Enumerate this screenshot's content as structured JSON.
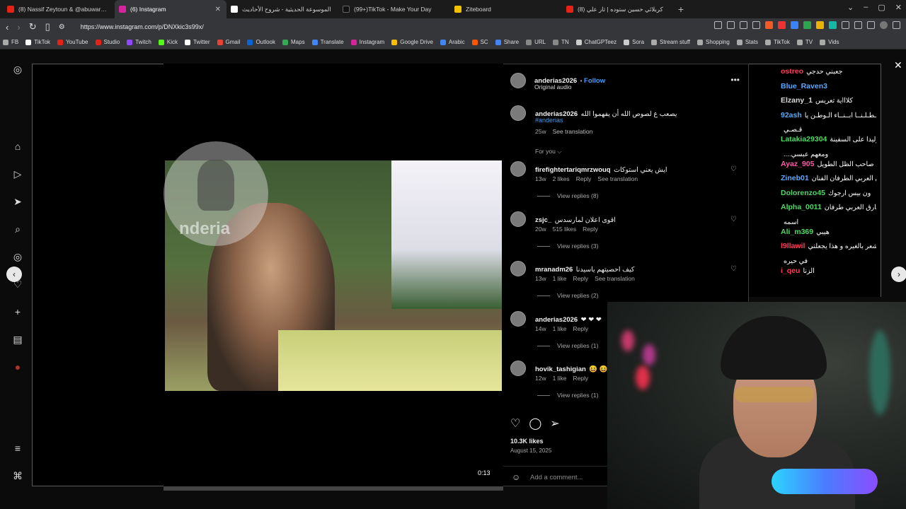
{
  "browser": {
    "tabs": [
      {
        "title": "(8) Nassif Zeytoun & @abuwardmusic",
        "fav_color": "#e62117",
        "active": false
      },
      {
        "title": "(6) Instagram",
        "fav_color": "#d6249f",
        "active": true
      },
      {
        "title": "الموسوعة الحديثية - شروح الأحاديث",
        "fav_color": "#ffffff",
        "active": false
      },
      {
        "title": "(99+)TikTok - Make Your Day",
        "fav_color": "#111111",
        "active": false
      },
      {
        "title": "Ziteboard",
        "fav_color": "#f2c200",
        "active": false
      },
      {
        "title": "(8) كربلائي حسين ستوده | ثار علي",
        "fav_color": "#e62117",
        "active": false
      }
    ],
    "new_tab": "+",
    "url": "https://www.instagram.com/p/DNXkic3s99x/",
    "bookmarks": [
      {
        "label": "FB",
        "color": "#aaaaaa"
      },
      {
        "label": "TikTok",
        "color": "#ffffff"
      },
      {
        "label": "YouTube",
        "color": "#e62117"
      },
      {
        "label": "Studio",
        "color": "#e62117"
      },
      {
        "label": "Twitch",
        "color": "#9146ff"
      },
      {
        "label": "Kick",
        "color": "#53fc18"
      },
      {
        "label": "Twitter",
        "color": "#ffffff"
      },
      {
        "label": "Gmail",
        "color": "#ea4335"
      },
      {
        "label": "Outlook",
        "color": "#0a64d6"
      },
      {
        "label": "Maps",
        "color": "#34a853"
      },
      {
        "label": "Translate",
        "color": "#4285f4"
      },
      {
        "label": "Instagram",
        "color": "#d6249f"
      },
      {
        "label": "Google Drive",
        "color": "#fbbc04"
      },
      {
        "label": "Arabic",
        "color": "#4285f4"
      },
      {
        "label": "SC",
        "color": "#ff5500"
      },
      {
        "label": "Share",
        "color": "#4285f4"
      },
      {
        "label": "URL",
        "color": "#888888"
      },
      {
        "label": "TN",
        "color": "#888888"
      },
      {
        "label": "ChatGPTeez",
        "color": "#cccccc"
      },
      {
        "label": "Sora",
        "color": "#cccccc"
      },
      {
        "label": "Stream stuff",
        "color": "#aaaaaa"
      },
      {
        "label": "Shopping",
        "color": "#aaaaaa"
      },
      {
        "label": "Stats",
        "color": "#aaaaaa"
      },
      {
        "label": "TikTok",
        "color": "#aaaaaa"
      },
      {
        "label": "TV",
        "color": "#aaaaaa"
      },
      {
        "label": "Vids",
        "color": "#aaaaaa"
      }
    ]
  },
  "post": {
    "watermark": "nderia",
    "video_time": "0:13",
    "author": "anderias2026",
    "follow_label": "Follow",
    "audio": "Original audio",
    "caption": {
      "user": "anderias2026",
      "text": "يصعب ع لصوص الله أن يفهموا الله",
      "hashtag": "#anderias",
      "age": "25w",
      "see_translation": "See translation"
    },
    "for_you": "For you ⌵",
    "comments": [
      {
        "user": "firefightertariqmrzwouq",
        "text": "ايش يعني استوكات",
        "age": "13w",
        "likes": "2 likes",
        "reply": "Reply",
        "translate": "See translation",
        "view_replies": "View replies (8)"
      },
      {
        "user": "zsjc_",
        "text": "اقوى اعلان لمارسدس",
        "age": "20w",
        "likes": "515 likes",
        "reply": "Reply",
        "translate": "",
        "view_replies": "View replies (3)"
      },
      {
        "user": "mranadm26",
        "text": "كيف احصيتهم ياسيدنا",
        "age": "13w",
        "likes": "1 like",
        "reply": "Reply",
        "translate": "See translation",
        "view_replies": "View replies (2)"
      },
      {
        "user": "anderias2026",
        "text": "❤ ❤ ❤",
        "age": "14w",
        "likes": "1 like",
        "reply": "Reply",
        "translate": "",
        "view_replies": "View replies (1)"
      },
      {
        "user": "hovik_tashigian",
        "text": "😆 😆 😆",
        "age": "12w",
        "likes": "1 like",
        "reply": "Reply",
        "translate": "",
        "view_replies": "View replies (1)"
      }
    ],
    "likes": "10.3K likes",
    "date": "August 15, 2025",
    "add_comment": "Add a comment..."
  },
  "stream_chat": [
    {
      "user": "ostreo",
      "color": "#ff3b5c",
      "msg": "جعبني حدجي"
    },
    {
      "user": "Blue_Raven3",
      "color": "#5aa9ff",
      "msg": ""
    },
    {
      "user": "Elzany_1",
      "color": "#d9d9d9",
      "msg": "كلاااية تعريس"
    },
    {
      "user": "92ash",
      "color": "#5aa9ff",
      "msg": "حـــطـلـنــا ابــنــاء الـوطـن يا"
    },
    {
      "user": "",
      "color": "#ffffff",
      "msg": "قـصـي"
    },
    {
      "user": "Latakia29304",
      "color": "#4cd964",
      "msg": "حدان وليدا على السفينة"
    },
    {
      "user": "",
      "color": "#ffffff",
      "msg": "....ومعهم عبسي"
    },
    {
      "user": "Ayaz_905",
      "color": "#ff5aa8",
      "msg": "يا صاحب الظل الطويل"
    },
    {
      "user": "Zineb01",
      "color": "#5aa9ff",
      "msg": "طارق العربي الطرفان الفنان"
    },
    {
      "user": "Dolorenzo45",
      "color": "#4cd964",
      "msg": "ون بيس ارجوك"
    },
    {
      "user": "Alpha_0011",
      "color": "#4cd964",
      "msg": "طارق العربي طرفان"
    },
    {
      "user": "",
      "color": "#ffffff",
      "msg": "اسمه"
    },
    {
      "user": "Ali_m369",
      "color": "#4cd964",
      "msg": "هيبي"
    },
    {
      "user": "l9llawil",
      "color": "#ff3b5c",
      "msg": "حطلنا اشعر بالغيره و هذا يجعلني"
    },
    {
      "user": "",
      "color": "#ffffff",
      "msg": "في حيره"
    },
    {
      "user": "i_qeu",
      "color": "#ff3b5c",
      "msg": "الزنا"
    }
  ]
}
